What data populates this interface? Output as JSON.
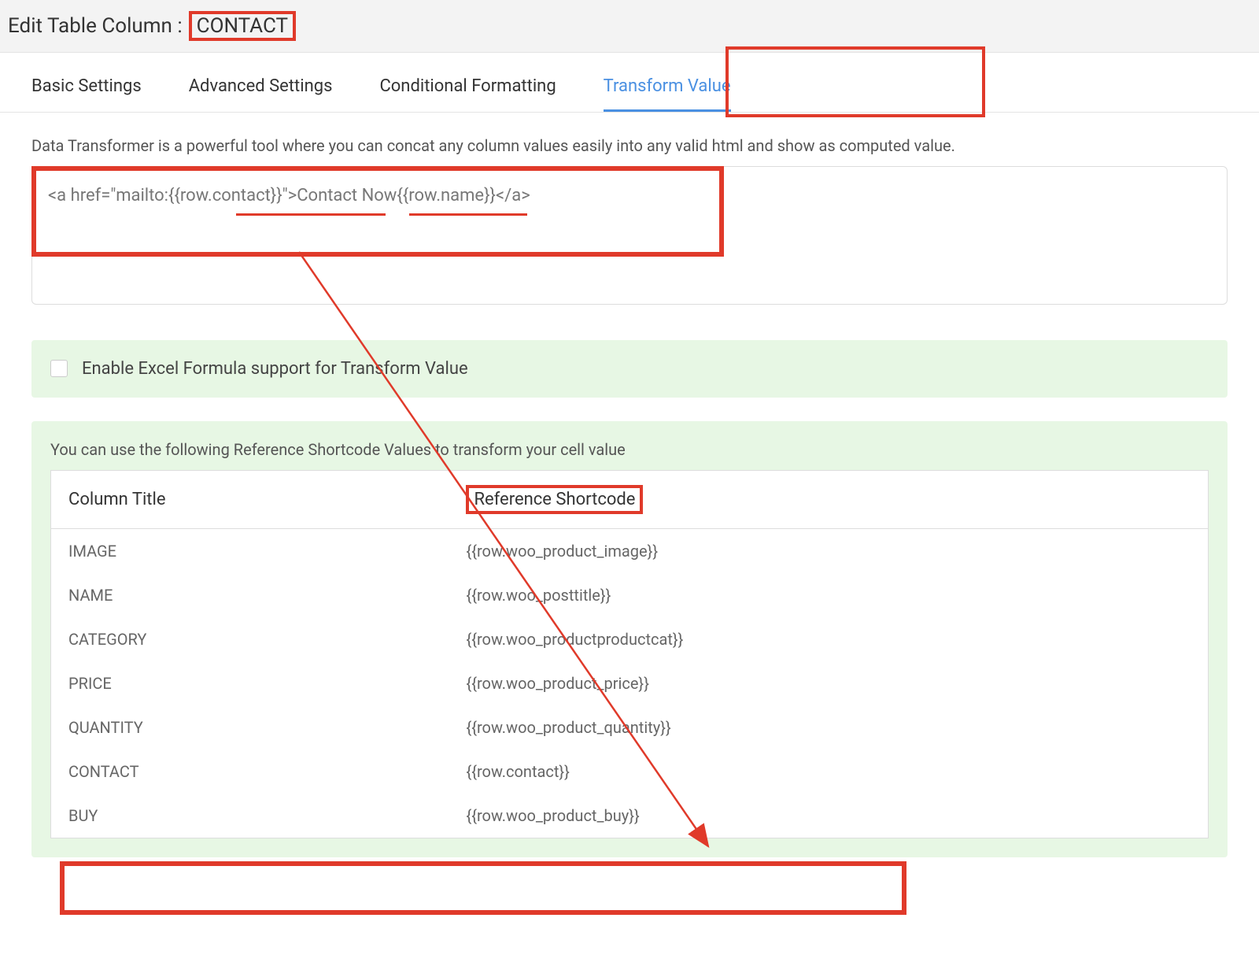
{
  "header": {
    "prefix": "Edit Table Column :",
    "column_name": "CONTACT"
  },
  "tabs": [
    {
      "label": "Basic Settings",
      "active": false
    },
    {
      "label": "Advanced Settings",
      "active": false
    },
    {
      "label": "Conditional Formatting",
      "active": false
    },
    {
      "label": "Transform Value",
      "active": true
    }
  ],
  "description": "Data Transformer is a powerful tool where you can concat any column values easily into any valid html and show as computed value.",
  "textarea_value": "<a href=\"mailto:{{row.contact}}\">Contact Now{{row.name}}</a>",
  "excel_checkbox": {
    "label": "Enable Excel Formula support for Transform Value",
    "checked": false
  },
  "shortcode_intro": "You can use the following Reference Shortcode Values to transform your cell value",
  "shortcode_table": {
    "headers": {
      "col1": "Column Title",
      "col2": "Reference Shortcode"
    },
    "rows": [
      {
        "title": "IMAGE",
        "code": "{{row.woo_product_image}}"
      },
      {
        "title": "NAME",
        "code": "{{row.woo_posttitle}}"
      },
      {
        "title": "CATEGORY",
        "code": "{{row.woo_productproductcat}}"
      },
      {
        "title": "PRICE",
        "code": "{{row.woo_product_price}}"
      },
      {
        "title": "QUANTITY",
        "code": "{{row.woo_product_quantity}}"
      },
      {
        "title": "CONTACT",
        "code": "{{row.contact}}"
      },
      {
        "title": "BUY",
        "code": "{{row.woo_product_buy}}"
      }
    ]
  }
}
